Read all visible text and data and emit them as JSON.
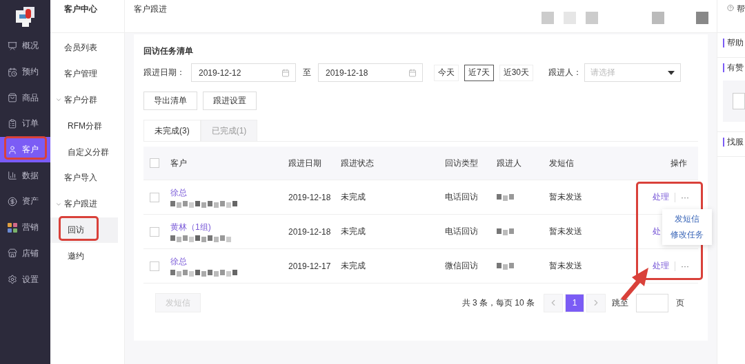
{
  "nav": {
    "items": [
      {
        "label": "概况",
        "selected": false,
        "highlighted": false
      },
      {
        "label": "预约",
        "selected": false,
        "highlighted": false
      },
      {
        "label": "商品",
        "selected": false,
        "highlighted": false
      },
      {
        "label": "订单",
        "selected": false,
        "highlighted": false
      },
      {
        "label": "客户",
        "selected": true,
        "highlighted": true
      },
      {
        "label": "数据",
        "selected": false,
        "highlighted": false
      },
      {
        "label": "资产",
        "selected": false,
        "highlighted": false
      },
      {
        "label": "营销",
        "selected": false,
        "highlighted": false
      },
      {
        "label": "店铺",
        "selected": false,
        "highlighted": false
      },
      {
        "label": "设置",
        "selected": false,
        "highlighted": false
      }
    ]
  },
  "subnav": {
    "title": "客户中心",
    "items": [
      {
        "label": "会员列表",
        "selected": false,
        "highlighted": false
      },
      {
        "label": "客户管理",
        "selected": false,
        "highlighted": false
      },
      {
        "label": "客户分群",
        "expanded": true,
        "children": [
          {
            "label": "RFM分群",
            "selected": false,
            "highlighted": false
          },
          {
            "label": "自定义分群",
            "selected": false,
            "highlighted": false
          }
        ]
      },
      {
        "label": "客户导入",
        "selected": false,
        "highlighted": false
      },
      {
        "label": "客户跟进",
        "expanded": true,
        "children": [
          {
            "label": "回访",
            "selected": true,
            "highlighted": true
          },
          {
            "label": "邀约",
            "selected": false,
            "highlighted": false
          }
        ]
      }
    ]
  },
  "header": {
    "breadcrumb": "客户跟进"
  },
  "help_panel": {
    "title": "帮",
    "sections": [
      "帮助",
      "有赞",
      "找服"
    ]
  },
  "task_list": {
    "title": "回访任务清单",
    "date_label": "跟进日期：",
    "date_from": "2019-12-12",
    "date_sep": "至",
    "date_to": "2019-12-18",
    "quick_ranges": [
      {
        "label": "今天",
        "selected": false
      },
      {
        "label": "近7天",
        "selected": true
      },
      {
        "label": "近30天",
        "selected": false
      }
    ],
    "follower_label": "跟进人：",
    "follower_placeholder": "请选择",
    "buttons": [
      "导出清单",
      "跟进设置"
    ],
    "tabs": [
      {
        "label": "未完成(3)",
        "selected": true
      },
      {
        "label": "已完成(1)",
        "selected": false
      }
    ],
    "table": {
      "columns": [
        "客户",
        "跟进日期",
        "跟进状态",
        "回访类型",
        "跟进人",
        "发短信",
        "操作"
      ],
      "header_checked": false,
      "actions_highlighted": true,
      "rows": [
        {
          "customer": "徐总",
          "date": "2019-12-18",
          "status": "未完成",
          "type": "电话回访",
          "sms": "暂未发送",
          "action": "处理",
          "more": "···",
          "checked": false
        },
        {
          "customer": "黄林（1组)",
          "date": "2019-12-18",
          "status": "未完成",
          "type": "电话回访",
          "sms": "暂未发送",
          "action": "处",
          "checked": false,
          "menu": [
            "发短信",
            "修改任务"
          ]
        },
        {
          "customer": "徐总",
          "date": "2019-12-17",
          "status": "未完成",
          "type": "微信回访",
          "sms": "暂未发送",
          "action": "处理",
          "more": "···",
          "checked": false
        }
      ]
    },
    "bulk_button": {
      "label": "发短信",
      "disabled": true
    },
    "pagination": {
      "summary": "共 3 条，每页 10 条",
      "pages": [
        {
          "label": "1",
          "selected": true
        }
      ],
      "jump_label": "跳至",
      "page_unit": "页"
    }
  },
  "annotations": {
    "arrow": true
  }
}
